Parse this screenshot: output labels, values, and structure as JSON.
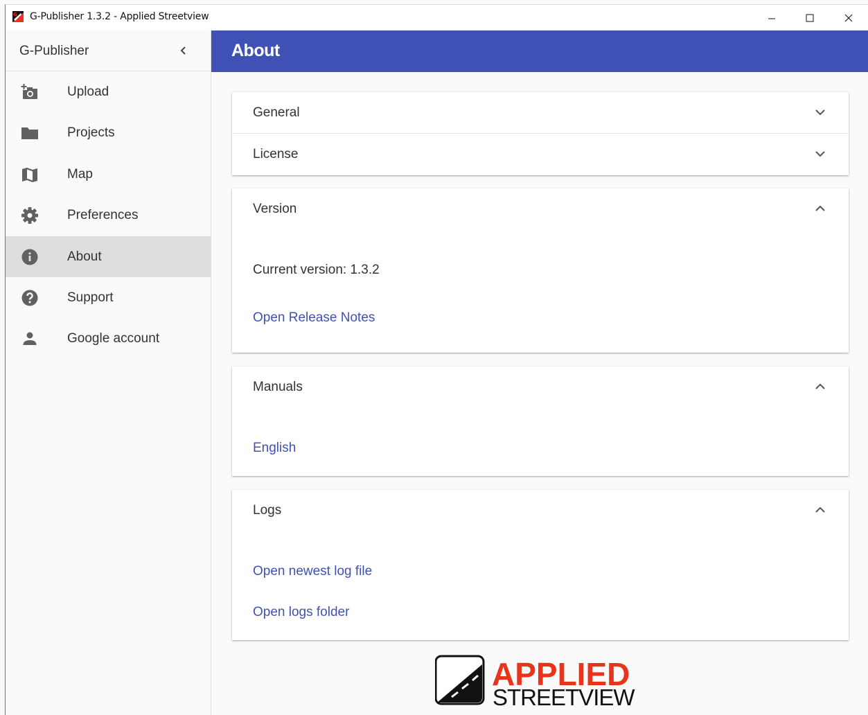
{
  "window": {
    "title": "G-Publisher 1.3.2 - Applied Streetview",
    "controls": [
      "minimize-icon",
      "maximize-icon",
      "close-icon"
    ]
  },
  "sidebar": {
    "title": "G-Publisher",
    "items": [
      {
        "label": "Upload",
        "icon": "add-photo-icon"
      },
      {
        "label": "Projects",
        "icon": "folder-icon"
      },
      {
        "label": "Map",
        "icon": "map-icon"
      },
      {
        "label": "Preferences",
        "icon": "gear-icon"
      },
      {
        "label": "About",
        "icon": "info-icon",
        "active": true
      },
      {
        "label": "Support",
        "icon": "help-icon"
      },
      {
        "label": "Google account",
        "icon": "person-icon"
      }
    ]
  },
  "header": {
    "title": "About"
  },
  "panels": {
    "general": {
      "title": "General",
      "expanded": false
    },
    "license": {
      "title": "License",
      "expanded": false
    },
    "version": {
      "title": "Version",
      "expanded": true,
      "current_version": "Current version: 1.3.2",
      "release_notes_link": "Open Release Notes"
    },
    "manuals": {
      "title": "Manuals",
      "expanded": true,
      "english_link": "English"
    },
    "logs": {
      "title": "Logs",
      "expanded": true,
      "newest_log_link": "Open newest log file",
      "logs_folder_link": "Open logs folder"
    }
  },
  "footer": {
    "logo_line1": "APPLIED",
    "logo_line2": "STREETVIEW"
  },
  "colors": {
    "primary": "#3f51b5",
    "logo_red": "#e8341c",
    "active_item_bg": "#dedede"
  }
}
